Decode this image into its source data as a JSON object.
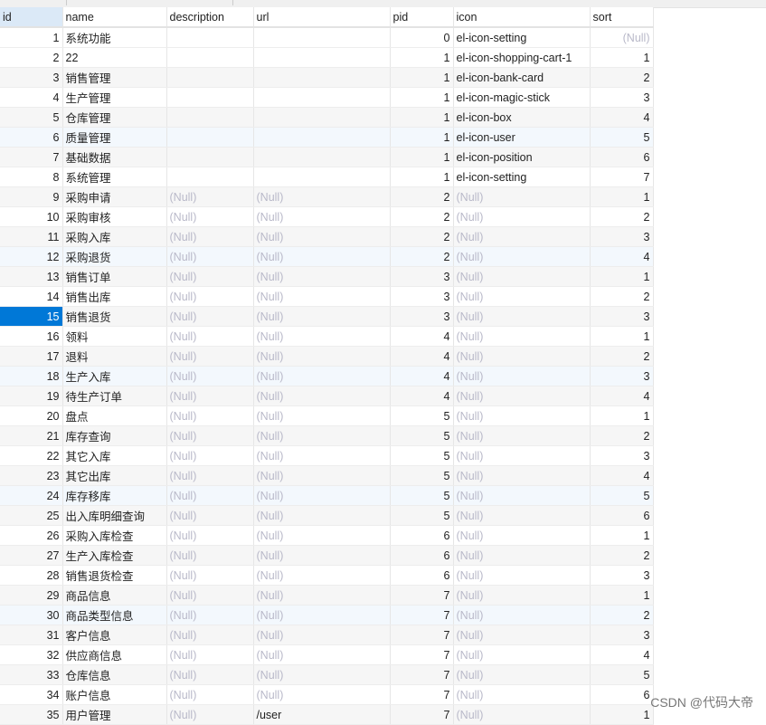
{
  "columns": [
    "id",
    "name",
    "description",
    "url",
    "pid",
    "icon",
    "sort"
  ],
  "rows": [
    [
      "1",
      "系统功能",
      "",
      "",
      "0",
      "el-icon-setting",
      null
    ],
    [
      "2",
      "22",
      "",
      "",
      "1",
      "el-icon-shopping-cart-1",
      "1"
    ],
    [
      "3",
      "销售管理",
      "",
      "",
      "1",
      "el-icon-bank-card",
      "2"
    ],
    [
      "4",
      "生产管理",
      "",
      "",
      "1",
      "el-icon-magic-stick",
      "3"
    ],
    [
      "5",
      "仓库管理",
      "",
      "",
      "1",
      "el-icon-box",
      "4"
    ],
    [
      "6",
      "质量管理",
      "",
      "",
      "1",
      "el-icon-user",
      "5"
    ],
    [
      "7",
      "基础数据",
      "",
      "",
      "1",
      "el-icon-position",
      "6"
    ],
    [
      "8",
      "系统管理",
      "",
      "",
      "1",
      "el-icon-setting",
      "7"
    ],
    [
      "9",
      "采购申请",
      null,
      null,
      "2",
      null,
      "1"
    ],
    [
      "10",
      "采购审核",
      null,
      null,
      "2",
      null,
      "2"
    ],
    [
      "11",
      "采购入库",
      null,
      null,
      "2",
      null,
      "3"
    ],
    [
      "12",
      "采购退货",
      null,
      null,
      "2",
      null,
      "4"
    ],
    [
      "13",
      "销售订单",
      null,
      null,
      "3",
      null,
      "1"
    ],
    [
      "14",
      "销售出库",
      null,
      null,
      "3",
      null,
      "2"
    ],
    [
      "15",
      "销售退货",
      null,
      null,
      "3",
      null,
      "3"
    ],
    [
      "16",
      "领料",
      null,
      null,
      "4",
      null,
      "1"
    ],
    [
      "17",
      "退料",
      null,
      null,
      "4",
      null,
      "2"
    ],
    [
      "18",
      "生产入库",
      null,
      null,
      "4",
      null,
      "3"
    ],
    [
      "19",
      "待生产订单",
      null,
      null,
      "4",
      null,
      "4"
    ],
    [
      "20",
      "盘点",
      null,
      null,
      "5",
      null,
      "1"
    ],
    [
      "21",
      "库存查询",
      null,
      null,
      "5",
      null,
      "2"
    ],
    [
      "22",
      "其它入库",
      null,
      null,
      "5",
      null,
      "3"
    ],
    [
      "23",
      "其它出库",
      null,
      null,
      "5",
      null,
      "4"
    ],
    [
      "24",
      "库存移库",
      null,
      null,
      "5",
      null,
      "5"
    ],
    [
      "25",
      "出入库明细查询",
      null,
      null,
      "5",
      null,
      "6"
    ],
    [
      "26",
      "采购入库检查",
      null,
      null,
      "6",
      null,
      "1"
    ],
    [
      "27",
      "生产入库检查",
      null,
      null,
      "6",
      null,
      "2"
    ],
    [
      "28",
      "销售退货检查",
      null,
      null,
      "6",
      null,
      "3"
    ],
    [
      "29",
      "商品信息",
      null,
      null,
      "7",
      null,
      "1"
    ],
    [
      "30",
      "商品类型信息",
      null,
      null,
      "7",
      null,
      "2"
    ],
    [
      "31",
      "客户信息",
      null,
      null,
      "7",
      null,
      "3"
    ],
    [
      "32",
      "供应商信息",
      null,
      null,
      "7",
      null,
      "4"
    ],
    [
      "33",
      "仓库信息",
      null,
      null,
      "7",
      null,
      "5"
    ],
    [
      "34",
      "账户信息",
      null,
      null,
      "7",
      null,
      "6"
    ],
    [
      "35",
      "用户管理",
      null,
      "/user",
      "7",
      null,
      "1"
    ]
  ],
  "selected_row": 15,
  "null_label": "(Null)",
  "watermark": "CSDN @代码大帝"
}
